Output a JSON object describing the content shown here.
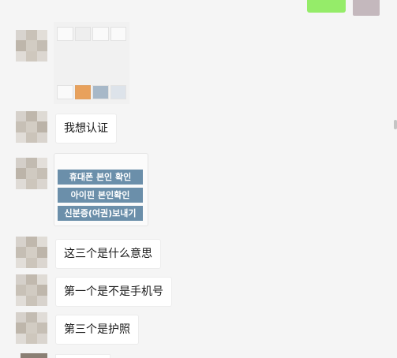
{
  "chat": {
    "top_sent_message": "",
    "image_message": "",
    "messages": [
      {
        "text": "我想认证"
      },
      {
        "text": "这三个是什么意思"
      },
      {
        "text": "第一个是不是手机号"
      },
      {
        "text": "第三个是护照"
      }
    ],
    "verification_options": [
      {
        "label": "휴대폰 본인 확인"
      },
      {
        "label": "아이핀 본인확인"
      },
      {
        "label": "신분증(여권)보내기"
      }
    ]
  },
  "colors": {
    "chat_background": "#f5f5f5",
    "bubble_background": "#ffffff",
    "sent_bubble": "#95ec69",
    "option_button": "#6b8faa"
  }
}
